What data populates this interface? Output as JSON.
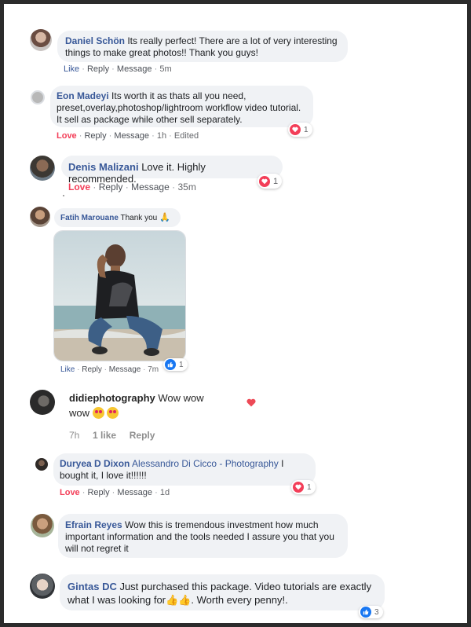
{
  "comments": [
    {
      "author": "Daniel Schön",
      "text": " Its really perfect! There are a lot of very interesting things to make great photos!! Thank you guys!",
      "actions": {
        "like": "Like",
        "reply": "Reply",
        "message": "Message",
        "time": "5m"
      }
    },
    {
      "author": "Eon Madeyi",
      "text": " Its worth it as thats all you need, preset,overlay,photoshop/lightroom workflow video tutorial. It sell as package while other sell separately.",
      "actions": {
        "love": "Love",
        "reply": "Reply",
        "message": "Message",
        "time": "1h",
        "edited": "Edited"
      },
      "reaction_count": "1"
    },
    {
      "author": "Denis Malizani",
      "text": " Love it. Highly recommended.",
      "actions": {
        "love": "Love",
        "reply": "Reply",
        "message": "Message",
        "time": "35m"
      },
      "reaction_count": "1"
    },
    {
      "author": "Fatih Marouane",
      "text": " Thank you ",
      "actions": {
        "like": "Like",
        "reply": "Reply",
        "message": "Message",
        "time": "7m"
      },
      "reaction_count": "1"
    },
    {
      "author": "didiephotography",
      "text_line1": " Wow wow",
      "text_line2": "wow ",
      "actions": {
        "time": "7h",
        "likes": "1 like",
        "reply": "Reply"
      }
    },
    {
      "author": "Duryea D Dixon",
      "mention": "Alessandro Di Cicco - Photography",
      "text": " I bought it, I love it!!!!!!",
      "actions": {
        "love": "Love",
        "reply": "Reply",
        "message": "Message",
        "time": "1d"
      },
      "reaction_count": "1"
    },
    {
      "author": "Efrain Reyes",
      "text": " Wow this is tremendous investment how much important information and the tools needed I assure you that you will not regret it"
    },
    {
      "author": "Gintas DC",
      "text_a": " Just purchased this package. Video tutorials are exactly what I was looking for",
      "text_b": ". Worth every penny!.",
      "reaction_count": "3"
    }
  ],
  "separators": {
    "dot": "·"
  },
  "icons": {
    "reaction_love": "heart-icon",
    "reaction_like": "thumbs-up-icon",
    "pray": "folded-hands-emoji",
    "heart_eyes": "heart-eyes-emoji",
    "thumbs": "thumbs-up-emoji"
  },
  "colors": {
    "author": "#385898",
    "love": "#f33e58",
    "bubble": "#f0f2f5",
    "like_blue": "#1877f2"
  }
}
